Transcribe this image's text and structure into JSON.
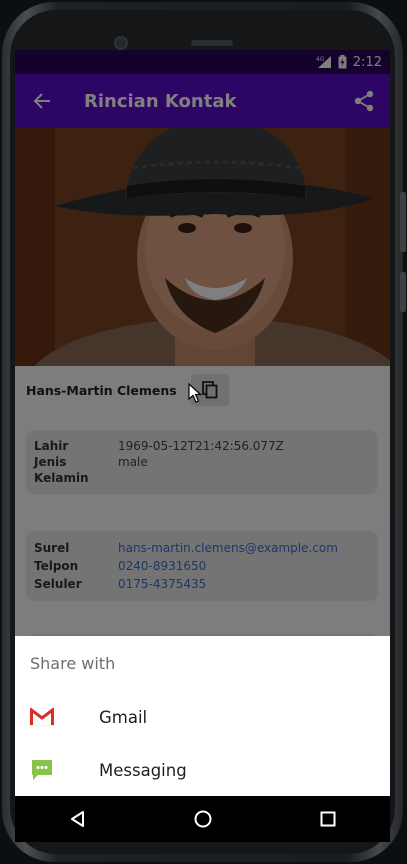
{
  "status_bar": {
    "network": "4G",
    "time": "2:12"
  },
  "app_bar": {
    "title": "Rincian Kontak"
  },
  "contact": {
    "name": "Hans-Martin Clemens",
    "details": [
      {
        "label": "Lahir",
        "value": "1969-05-12T21:42:56.077Z"
      },
      {
        "label": "Jenis Kelamin",
        "value": "male"
      }
    ],
    "contacts": [
      {
        "label": "Surel",
        "value": "hans-martin.clemens@example.com"
      },
      {
        "label": "Telpon",
        "value": "0240-8931650"
      },
      {
        "label": "Seluler",
        "value": "0175-4375435"
      }
    ]
  },
  "share_sheet": {
    "title": "Share with",
    "items": [
      {
        "label": "Gmail",
        "icon": "gmail-icon"
      },
      {
        "label": "Messaging",
        "icon": "messaging-icon"
      }
    ]
  },
  "colors": {
    "app_bar": "#5a0bc8",
    "status_bar": "#2a0558",
    "link": "#3b6fd1"
  }
}
